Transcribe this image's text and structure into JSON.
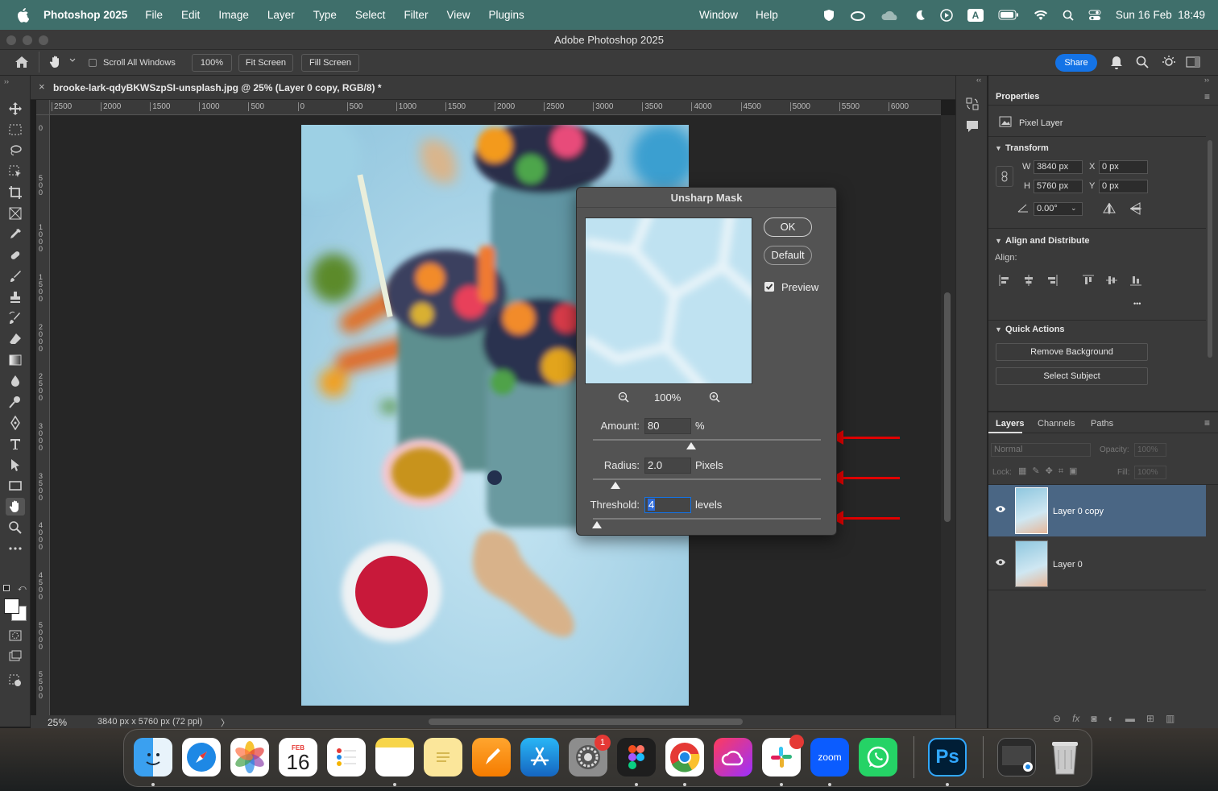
{
  "menubar": {
    "app_name": "Photoshop 2025",
    "items": [
      "File",
      "Edit",
      "Image",
      "Layer",
      "Type",
      "Select",
      "Filter",
      "View",
      "Plugins"
    ],
    "right_items": [
      "Window",
      "Help"
    ],
    "input_badge": "A",
    "datetime": "Sun 16 Feb  18:49"
  },
  "window": {
    "title": "Adobe Photoshop 2025"
  },
  "options": {
    "scroll_all": "Scroll All Windows",
    "zoom_btn": "100%",
    "fit_screen": "Fit Screen",
    "fill_screen": "Fill Screen",
    "share": "Share"
  },
  "document": {
    "tab_title": "brooke-lark-qdyBKWSzpSI-unsplash.jpg @ 25% (Layer 0 copy, RGB/8) *",
    "close": "×",
    "hruler_labels": [
      "2500",
      "2000",
      "1500",
      "1000",
      "500",
      "0",
      "500",
      "1000",
      "1500",
      "2000",
      "2500",
      "3000",
      "3500",
      "4000",
      "4500",
      "5000",
      "5500",
      "6000"
    ],
    "vruler_labels": [
      "0",
      "5 0 0",
      "1 0 0 0",
      "1 5 0 0",
      "2 0 0 0",
      "2 5 0 0",
      "3 0 0 0",
      "3 5 0 0",
      "4 0 0 0",
      "4 5 0 0",
      "5 0 0 0",
      "5 5 0 0"
    ]
  },
  "status": {
    "zoom": "25%",
    "dimensions": "3840 px x 5760 px (72 ppi)",
    "chevron": "〉"
  },
  "dialog": {
    "title": "Unsharp Mask",
    "ok": "OK",
    "default": "Default",
    "preview_label": "Preview",
    "preview_checked": true,
    "preview_zoom": "100%",
    "amount_label": "Amount:",
    "amount_value": "80",
    "amount_unit": "%",
    "amount_slider_fraction": 0.43,
    "radius_label": "Radius:",
    "radius_value": "2.0",
    "radius_unit": "Pixels",
    "radius_slider_fraction": 0.1,
    "threshold_label": "Threshold:",
    "threshold_value": "4",
    "threshold_unit": "levels",
    "threshold_slider_fraction": 0.016
  },
  "properties": {
    "tab": "Properties",
    "kind": "Pixel Layer",
    "transform_title": "Transform",
    "w_label": "W",
    "w_value": "3840 px",
    "h_label": "H",
    "h_value": "5760 px",
    "x_label": "X",
    "x_value": "0 px",
    "y_label": "Y",
    "y_value": "0 px",
    "angle_value": "0.00°",
    "align_title": "Align and Distribute",
    "align_label": "Align:",
    "more": "•••",
    "quick_title": "Quick Actions",
    "remove_bg": "Remove Background",
    "select_subject": "Select Subject"
  },
  "layers_panel": {
    "tabs": [
      "Layers",
      "Channels",
      "Paths"
    ],
    "blend_mode": "Normal",
    "opacity_label": "Opacity:",
    "opacity_value": "100%",
    "lock_label": "Lock:",
    "fill_label": "Fill:",
    "fill_value": "100%",
    "layers": [
      {
        "name": "Layer 0 copy",
        "selected": true
      },
      {
        "name": "Layer 0",
        "selected": false
      }
    ]
  },
  "dock": {
    "calendar_month": "FEB",
    "calendar_day": "16",
    "settings_badge": "1",
    "zoom_label": "zoom",
    "ps_label": "Ps"
  },
  "colors": {
    "menubar": "#3f6f6b",
    "accent": "#1473e6",
    "annotation_arrow": "#e00000",
    "selected_layer": "#4a6684"
  }
}
